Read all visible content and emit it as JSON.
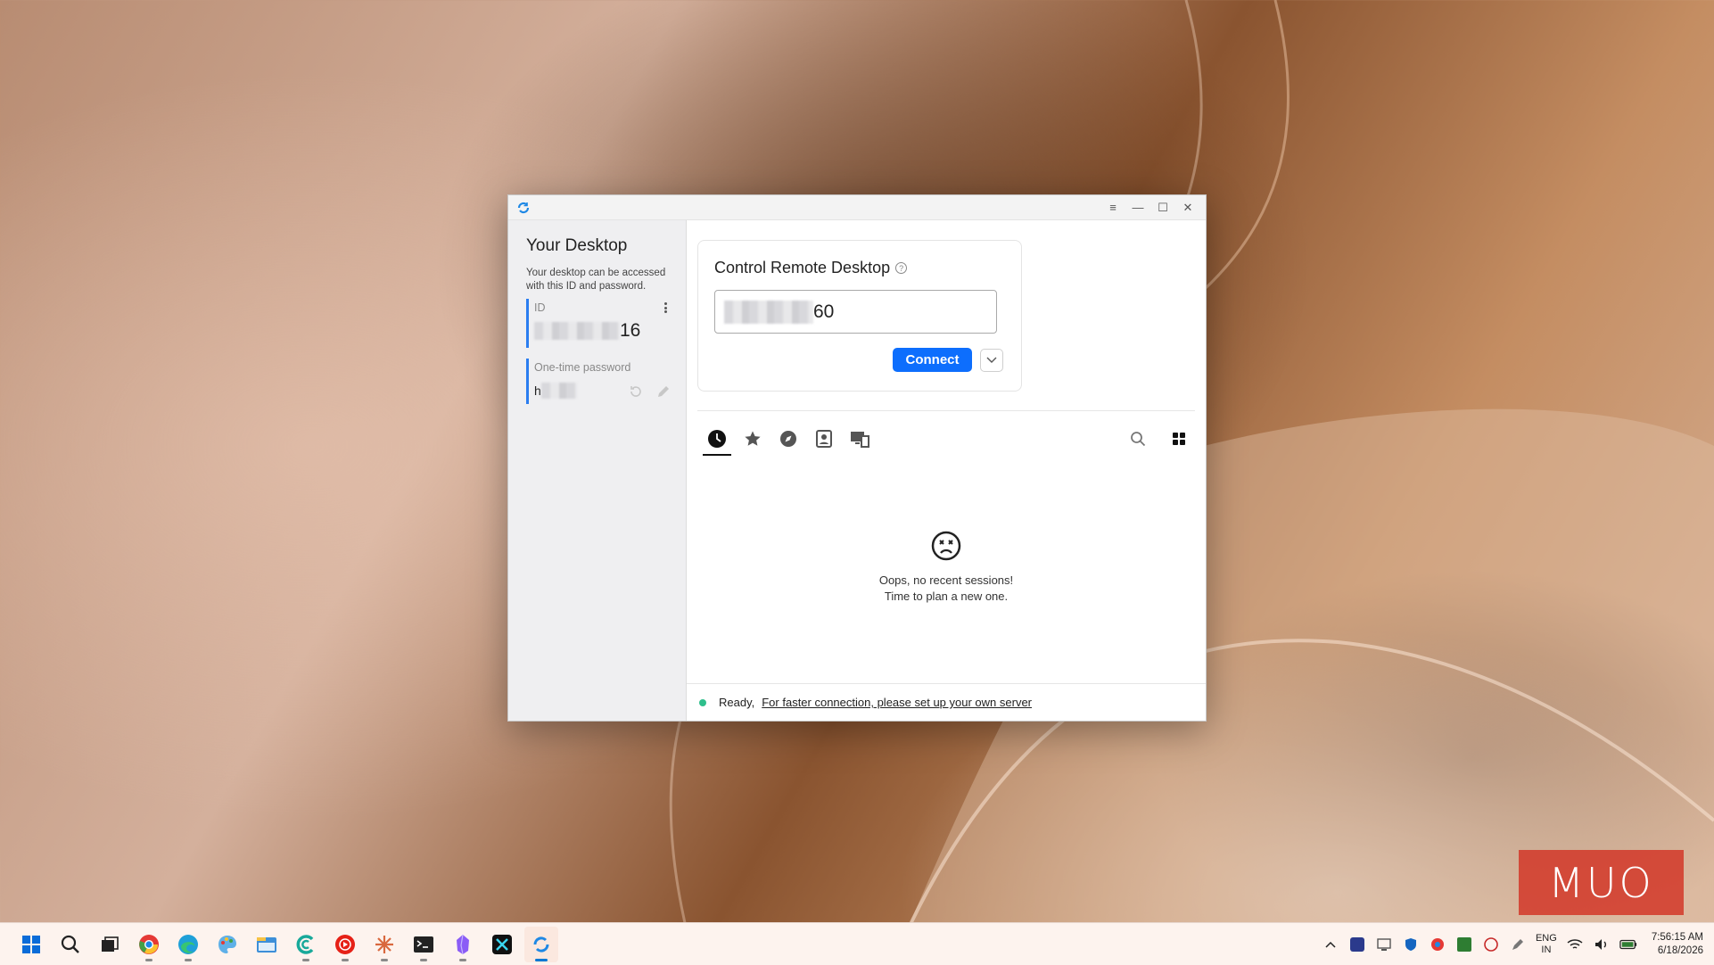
{
  "window": {
    "controls": [
      "≡",
      "—",
      "☐",
      "✕"
    ]
  },
  "sidebar": {
    "title": "Your Desktop",
    "description": "Your desktop can be accessed with this ID and password.",
    "id_label": "ID",
    "id_value_visible": "16",
    "password_label": "One-time password",
    "password_value_visible": "h"
  },
  "remote": {
    "title": "Control Remote Desktop",
    "help": "?",
    "id_input_visible": "60",
    "connect_label": "Connect"
  },
  "tabs": [
    {
      "icon": "recent-icon",
      "active": true
    },
    {
      "icon": "star-icon",
      "active": false
    },
    {
      "icon": "compass-icon",
      "active": false
    },
    {
      "icon": "address-book-icon",
      "active": false
    },
    {
      "icon": "lan-devices-icon",
      "active": false
    }
  ],
  "empty": {
    "line1": "Oops, no recent sessions!",
    "line2": "Time to plan a new one."
  },
  "status": {
    "ready": "Ready,",
    "link": "For faster connection, please set up your own server",
    "dot_color": "#2fbf8c"
  },
  "taskbar": {
    "lang_top": "ENG",
    "lang_bottom": "IN",
    "time": "7:56:15 AM",
    "date": "6/18/2026"
  },
  "watermark": "MUO",
  "colors": {
    "accent": "#0d6efd",
    "id_bar": "#2a7df0"
  }
}
